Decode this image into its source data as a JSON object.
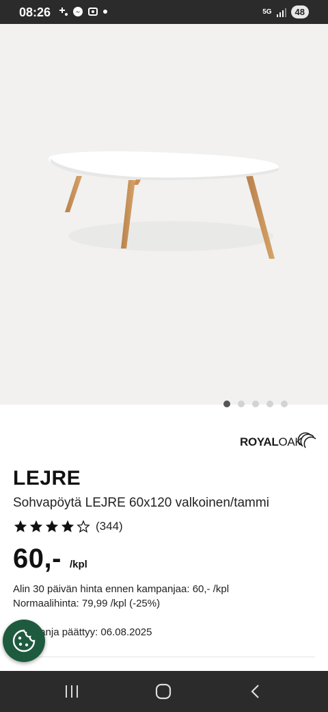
{
  "status_bar": {
    "time": "08:26",
    "network": "5G",
    "battery": "48",
    "icons": [
      "tiny-plus-icon",
      "messenger-icon",
      "screenshot-icon",
      "dot-icon"
    ]
  },
  "gallery": {
    "image_name": "coffee-table-image",
    "dots": 5,
    "active_index": 0
  },
  "brand": {
    "name_bold": "ROYAL",
    "name_light": "OAK"
  },
  "product": {
    "title": "LEJRE",
    "description": "Sohvapöytä LEJRE 60x120 valkoinen/tammi",
    "rating": 4,
    "rating_max": 5,
    "review_count": "(344)",
    "price": "60,-",
    "price_unit": "/kpl",
    "lowest_price_text": "Alin 30 päivän hinta ennen kampanjaa: 60,- /kpl",
    "normal_price_text": "Normaalihinta: 79,99 /kpl (-25%)",
    "campaign_text": "Kampanja päättyy: 06.08.2025"
  },
  "colors": {
    "status_bg": "#2b2b2b",
    "image_bg": "#f2f1f0",
    "cookie_btn": "#1e5a3e"
  },
  "nav": {
    "items": [
      "recent-apps-icon",
      "home-icon",
      "back-icon"
    ]
  }
}
